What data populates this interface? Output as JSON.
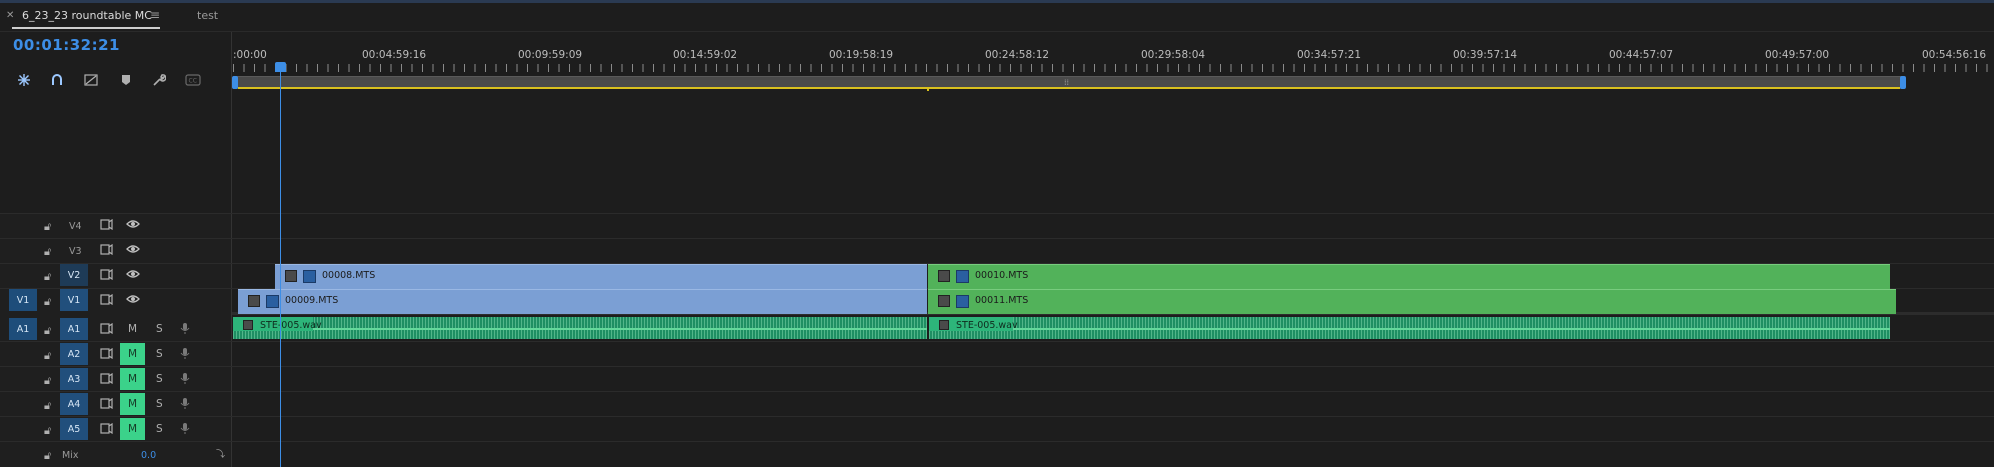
{
  "tabs": [
    {
      "label": "6_23_23 roundtable MC",
      "active": true
    },
    {
      "label": "test",
      "active": false
    }
  ],
  "sequence": {
    "timecode": "00:01:32:21"
  },
  "ruler": {
    "labels": [
      ":00:00",
      "00:04:59:16",
      "00:09:59:09",
      "00:14:59:02",
      "00:19:58:19",
      "00:24:58:12",
      "00:29:58:04",
      "00:34:57:21",
      "00:39:57:14",
      "00:44:57:07",
      "00:49:57:00",
      "00:54:56:16"
    ]
  },
  "tools": [
    {
      "name": "snap-icon"
    },
    {
      "name": "linked-selection-icon"
    },
    {
      "name": "add-marker-icon"
    },
    {
      "name": "marker-icon"
    },
    {
      "name": "wrench-icon"
    },
    {
      "name": "captions-icon"
    }
  ],
  "video_tracks": [
    {
      "id": "V4",
      "source": ""
    },
    {
      "id": "V3",
      "source": ""
    },
    {
      "id": "V2",
      "source": ""
    },
    {
      "id": "V1",
      "source": "V1"
    }
  ],
  "audio_tracks": [
    {
      "id": "A1",
      "source": "A1",
      "mute_label": "M",
      "solo_label": "S",
      "mute_on": false
    },
    {
      "id": "A2",
      "source": "",
      "mute_label": "M",
      "solo_label": "S",
      "mute_on": true
    },
    {
      "id": "A3",
      "source": "",
      "mute_label": "M",
      "solo_label": "S",
      "mute_on": true
    },
    {
      "id": "A4",
      "source": "",
      "mute_label": "M",
      "solo_label": "S",
      "mute_on": true
    },
    {
      "id": "A5",
      "source": "",
      "mute_label": "M",
      "solo_label": "S",
      "mute_on": true
    }
  ],
  "mix": {
    "label": "Mix",
    "value": "0.0"
  },
  "clips": {
    "v2_a": "00008.MTS",
    "v2_b": "00010.MTS",
    "v1_a": "00009.MTS",
    "v1_b": "00011.MTS",
    "a1_a": "STE-005.wav",
    "a1_b": "STE-005.wav"
  },
  "colors": {
    "accent": "#3d8ee6",
    "clip_blue": "#7b9fd4",
    "clip_green": "#52b25a",
    "audio": "#1e8f63",
    "work_area": "#d9c01e"
  }
}
